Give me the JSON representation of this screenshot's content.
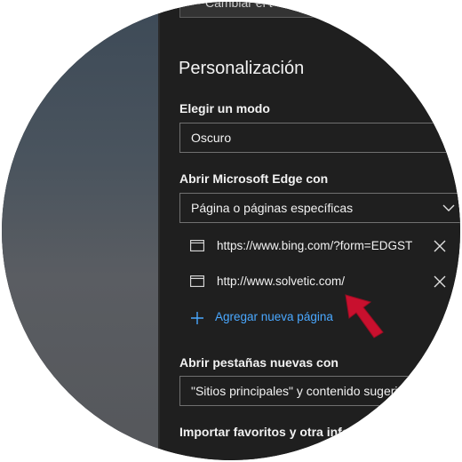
{
  "top_button": {
    "label": "Cambiar el t"
  },
  "section": {
    "title": "Personalización"
  },
  "mode": {
    "label": "Elegir un modo",
    "value": "Oscuro"
  },
  "startup": {
    "label": "Abrir Microsoft Edge con",
    "value": "Página o páginas específicas",
    "pages": [
      {
        "url": "https://www.bing.com/?form=EDGSTP"
      },
      {
        "url": "http://www.solvetic.com/"
      }
    ],
    "add_label": "Agregar nueva página"
  },
  "new_tabs": {
    "label": "Abrir pestañas nuevas con",
    "value": "\"Sitios principales\" y contenido sugerido"
  },
  "import": {
    "label": "Importar favoritos y otra información"
  },
  "colors": {
    "accent": "#4aa8ff",
    "panel": "#1f1f1f",
    "arrow": "#c8102e"
  }
}
